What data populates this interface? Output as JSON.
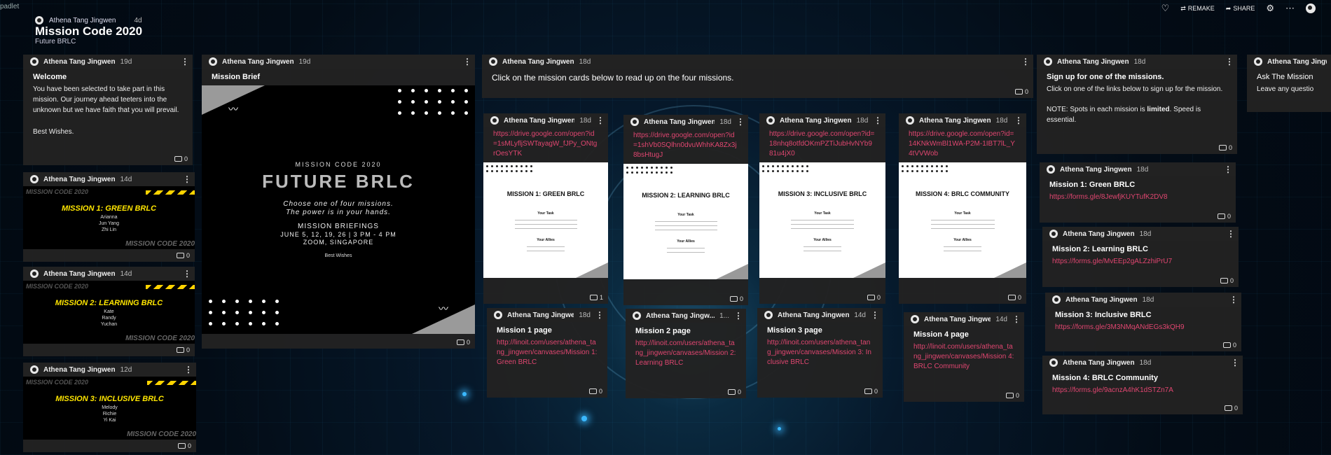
{
  "app": {
    "brand": "padlet"
  },
  "header": {
    "author": "Athena Tang Jingwen",
    "time": "4d",
    "title": "Mission Code 2020",
    "subtitle": "Future BRLC"
  },
  "actions": {
    "remake": "REMAKE",
    "share": "SHARE"
  },
  "icons": {
    "like": "heart-icon",
    "remake": "remake-icon",
    "share": "share-icon",
    "settings": "gear-icon",
    "more": "more-icon"
  },
  "colors": {
    "link": "#e04670",
    "card": "#222222",
    "accent_yellow": "#ffe600"
  },
  "cards": {
    "welcome": {
      "author": "Athena Tang Jingwen",
      "time": "19d",
      "title": "Welcome",
      "body": "You have been selected to take part in this mission. Our journey ahead teeters into the unknown but we have faith that you will prevail.",
      "sign": "Best Wishes.",
      "count": "0"
    },
    "m1_banner": {
      "author": "Athena Tang Jingwen",
      "time": "14d",
      "top": "MISSION CODE 2020",
      "heading": "MISSION 1: GREEN BRLC",
      "names": [
        "Arianna",
        "Jun Yang",
        "Zhi Lin"
      ],
      "bottom": "MISSION CODE 2020",
      "count": "0"
    },
    "m2_banner": {
      "author": "Athena Tang Jingwen",
      "time": "14d",
      "top": "MISSION CODE 2020",
      "heading": "MISSION 2: LEARNING BRLC",
      "names": [
        "Kate",
        "Randy",
        "Yuchan"
      ],
      "bottom": "MISSION CODE 2020",
      "count": "0"
    },
    "m3_banner": {
      "author": "Athena Tang Jingwen",
      "time": "12d",
      "top": "MISSION CODE 2020",
      "heading": "MISSION 3: INCLUSIVE BRLC",
      "names": [
        "Melody",
        "Richie",
        "Yi Kai"
      ],
      "bottom": "MISSION CODE 2020",
      "count": "0"
    },
    "brief": {
      "author": "Athena Tang Jingwen",
      "time": "19d",
      "title": "Mission Brief",
      "poster_top": "MISSION CODE 2020",
      "poster_title": "FUTURE BRLC",
      "tag1": "Choose one of four missions.",
      "tag2": "The power is in your hands.",
      "briefings": "MISSION BRIEFINGS",
      "dates": "JUNE 5, 12, 19, 26 | 3 PM - 4 PM",
      "venue": "ZOOM, SINGAPORE",
      "wishes": "Best Wishes",
      "count": "0"
    },
    "intro": {
      "author": "Athena Tang Jingwen",
      "time": "18d",
      "title": "Click on the mission cards below to read up on the four missions.",
      "count": "0"
    },
    "mc1": {
      "author": "Athena Tang Jingwen",
      "time": "18d",
      "link": "https://drive.google.com/open?id=1sMLyfljSWTayagW_fJPy_ONtgrOesYTK",
      "doc_title": "MISSION 1: GREEN BRLC",
      "task": "Your Task",
      "allies": "Your Allies",
      "count": "1"
    },
    "mc2": {
      "author": "Athena Tang Jingwen",
      "time": "18d",
      "link": "https://drive.google.com/open?id=1shVb0SQlhn0dvuWhhKA8Zx3j8bsHtugJ",
      "doc_title": "MISSION 2: LEARNING BRLC",
      "task": "Your Task",
      "allies": "Your Allies",
      "count": "0"
    },
    "mc3": {
      "author": "Athena Tang Jingwen",
      "time": "18d",
      "link": "https://drive.google.com/open?id=18nhq8otfdOKmPZTiJubHvNYb981u4jX0",
      "doc_title": "MISSION 3: INCLUSIVE BRLC",
      "task": "Your Task",
      "allies": "Your Allies",
      "count": "0"
    },
    "mc4": {
      "author": "Athena Tang Jingwen",
      "time": "18d",
      "link": "https://drive.google.com/open?id=14KNkWmBl1WA-P2M-1IBT7lL_Y4tVVWob",
      "doc_title": "MISSION 4: BRLC COMMUNITY",
      "task": "Your Task",
      "allies": "Your Allies",
      "count": "0"
    },
    "mp1": {
      "author": "Athena Tang Jingwen",
      "time": "18d",
      "title": "Mission 1 page",
      "link": "http://linoit.com/users/athena_tang_jingwen/canvases/Mission 1: Green BRLC",
      "count": "0"
    },
    "mp2": {
      "author": "Athena Tang Jingw...",
      "time": "1...",
      "title": "Mission 2 page",
      "link": "http://linoit.com/users/athena_tang_jingwen/canvases/Mission 2: Learning BRLC",
      "count": "0"
    },
    "mp3": {
      "author": "Athena Tang Jingwen",
      "time": "14d",
      "title": "Mission 3 page",
      "link": "http://linoit.com/users/athena_tang_jingwen/canvases/Mission 3: Inclusive BRLC",
      "count": "0"
    },
    "mp4": {
      "author": "Athena Tang Jingwen",
      "time": "14d",
      "title": "Mission 4 page",
      "link": "http://linoit.com/users/athena_tang_jingwen/canvases/Mission 4: BRLC Community",
      "count": "0"
    },
    "signup": {
      "author": "Athena Tang Jingwen",
      "time": "18d",
      "title": "Sign up for one of the missions.",
      "body": "Click on one of the links below to sign up for the mission.",
      "note_a": "NOTE: Spots in each mission is ",
      "note_b": "limited",
      "note_c": ". Speed is essential.",
      "count": "0"
    },
    "f1": {
      "author": "Athena Tang Jingwen",
      "time": "18d",
      "title": "Mission 1: Green BRLC",
      "link": "https://forms.gle/8JewfjKUYTufK2DV8",
      "count": "0"
    },
    "f2": {
      "author": "Athena Tang Jingwen",
      "time": "18d",
      "title": "Mission 2: Learning BRLC",
      "link": "https://forms.gle/MvEEp2gALZzhiPrU7",
      "count": "0"
    },
    "f3": {
      "author": "Athena Tang Jingwen",
      "time": "18d",
      "title": "Mission 3: Inclusive BRLC",
      "link": "https://forms.gle/3M3NMqANdEGs3kQH9",
      "count": "0"
    },
    "f4": {
      "author": "Athena Tang Jingwen",
      "time": "18d",
      "title": "Mission 4: BRLC Community",
      "link": "https://forms.gle/9acnzA4hK1dSTZn7A",
      "count": "0"
    },
    "ask": {
      "author": "Athena Tang Jingwen",
      "title": "Ask The Mission",
      "body": "Leave any questio"
    }
  }
}
